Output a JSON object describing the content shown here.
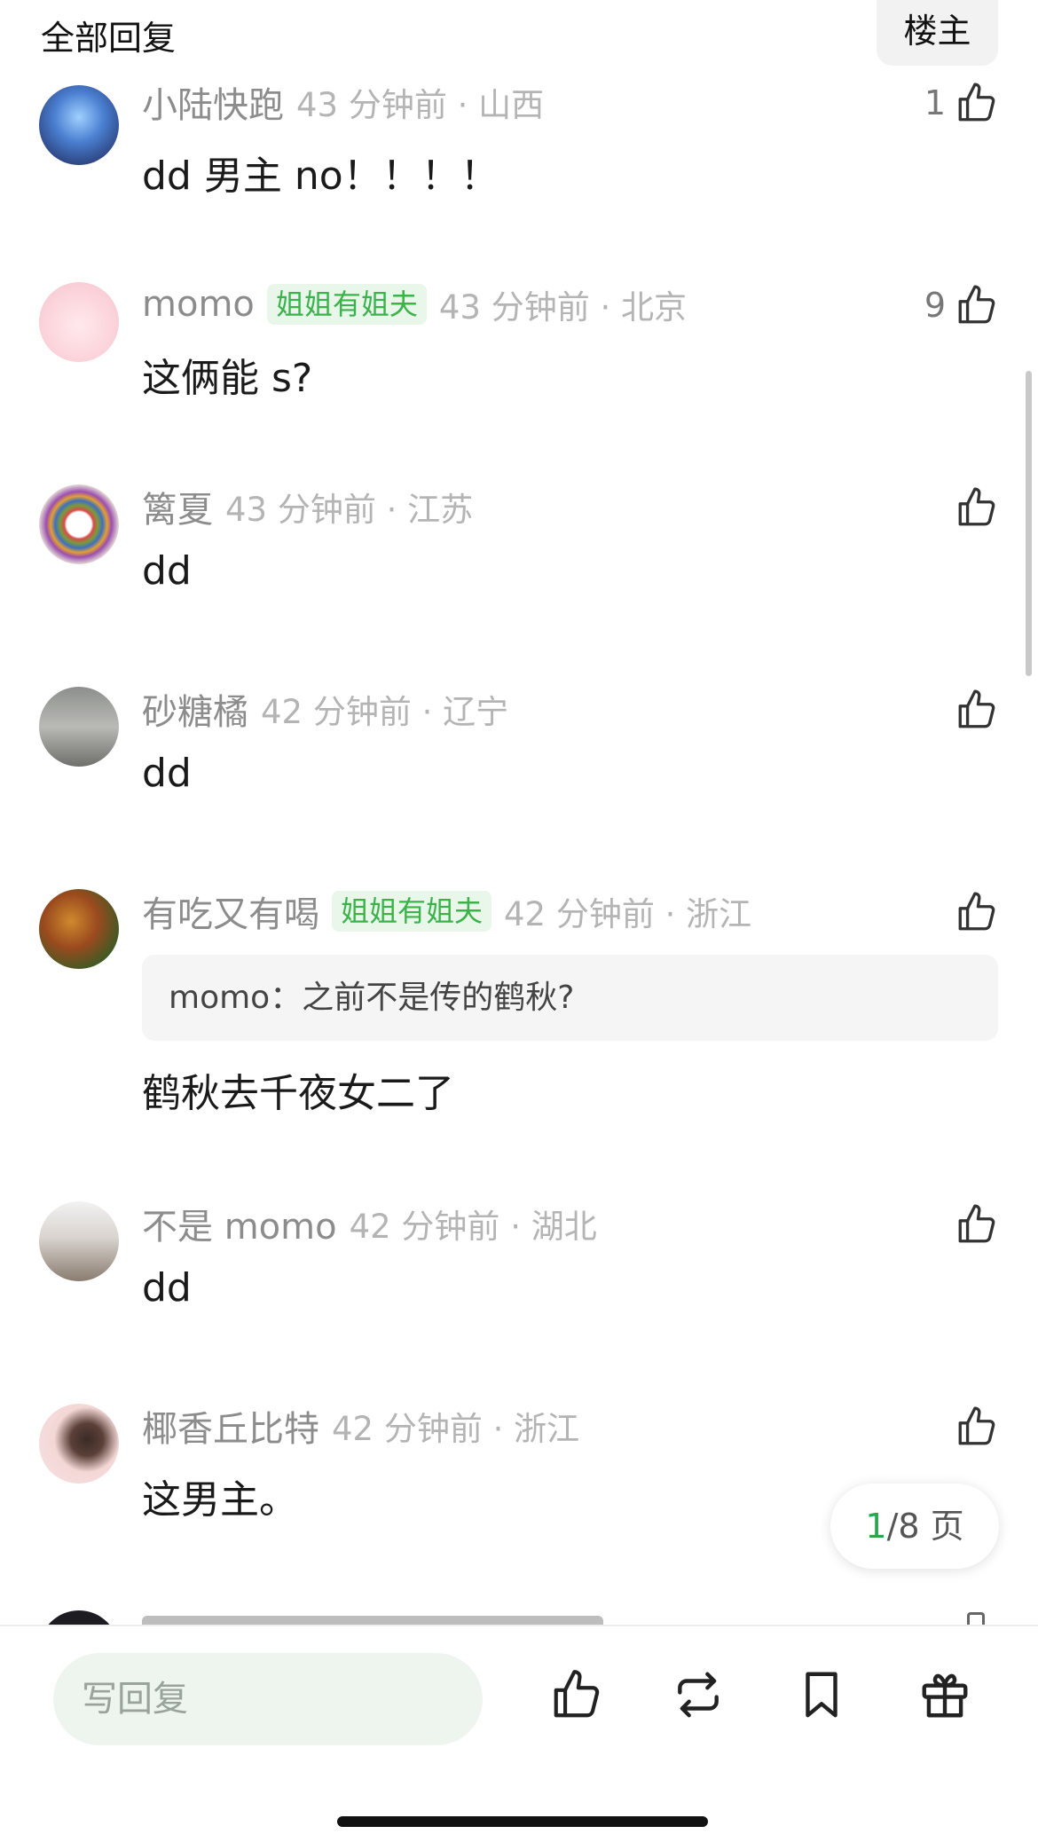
{
  "header": {
    "title": "全部回复",
    "op_button": "楼主"
  },
  "comments": [
    {
      "name": "小陆快跑",
      "badge": "",
      "time": "43 分钟前 · 山西",
      "likes": "1",
      "quote": "",
      "content": "dd 男主 no！！！！"
    },
    {
      "name": "momo",
      "badge": "姐姐有姐夫",
      "time": "43 分钟前 · 北京",
      "likes": "9",
      "quote": "",
      "content": "这俩能 s?"
    },
    {
      "name": "篱夏",
      "badge": "",
      "time": "43 分钟前 · 江苏",
      "likes": "",
      "quote": "",
      "content": "dd"
    },
    {
      "name": "砂糖橘",
      "badge": "",
      "time": "42 分钟前 · 辽宁",
      "likes": "",
      "quote": "",
      "content": "dd"
    },
    {
      "name": "有吃又有喝",
      "badge": "姐姐有姐夫",
      "time": "42 分钟前 · 浙江",
      "likes": "",
      "quote": "momo：之前不是传的鹤秋?",
      "content": "鹤秋去千夜女二了"
    },
    {
      "name": "不是 momo",
      "badge": "",
      "time": "42 分钟前 · 湖北",
      "likes": "",
      "quote": "",
      "content": "dd"
    },
    {
      "name": "椰香丘比特",
      "badge": "",
      "time": "42 分钟前 · 浙江",
      "likes": "",
      "quote": "",
      "content": "这男主。"
    }
  ],
  "pager": {
    "current": "1",
    "total_text": "/8 页"
  },
  "bottom_bar": {
    "reply_placeholder": "写回复"
  },
  "colors": {
    "accent_green": "#2ea44f",
    "badge_green": "#3bb34a",
    "badge_bg": "#e9f7ea"
  },
  "icons": [
    "thumbs-up-icon",
    "repost-icon",
    "bookmark-icon",
    "gift-icon"
  ]
}
